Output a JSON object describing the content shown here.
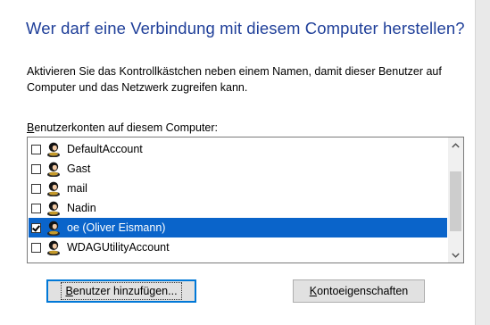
{
  "dialog": {
    "title": "Wer darf eine Verbindung mit diesem Computer herstellen?",
    "instructions": "Aktivieren Sie das Kontrollkästchen neben einem Namen, damit dieser Benutzer auf\nComputer und das Netzwerk zugreifen kann.",
    "list_label_mnemonic": "B",
    "list_label_rest": "enutzerkonten auf diesem Computer:"
  },
  "accounts": [
    {
      "name": "DefaultAccount",
      "checked": false,
      "selected": false
    },
    {
      "name": "Gast",
      "checked": false,
      "selected": false
    },
    {
      "name": "mail",
      "checked": false,
      "selected": false
    },
    {
      "name": "Nadin",
      "checked": false,
      "selected": false
    },
    {
      "name": "oe (Oliver Eismann)",
      "checked": true,
      "selected": true
    },
    {
      "name": "WDAGUtilityAccount",
      "checked": false,
      "selected": false
    }
  ],
  "buttons": {
    "add_mnemonic": "B",
    "add_rest": "enutzer hinzufügen...",
    "props_mnemonic": "K",
    "props_rest": "ontoeigenschaften"
  },
  "icons": {
    "user": "user-account-icon",
    "scroll_up": "chevron-up-icon",
    "scroll_down": "chevron-down-icon"
  },
  "colors": {
    "title": "#1f3f99",
    "selection": "#0a64ca",
    "default_button_border": "#0078d7"
  }
}
